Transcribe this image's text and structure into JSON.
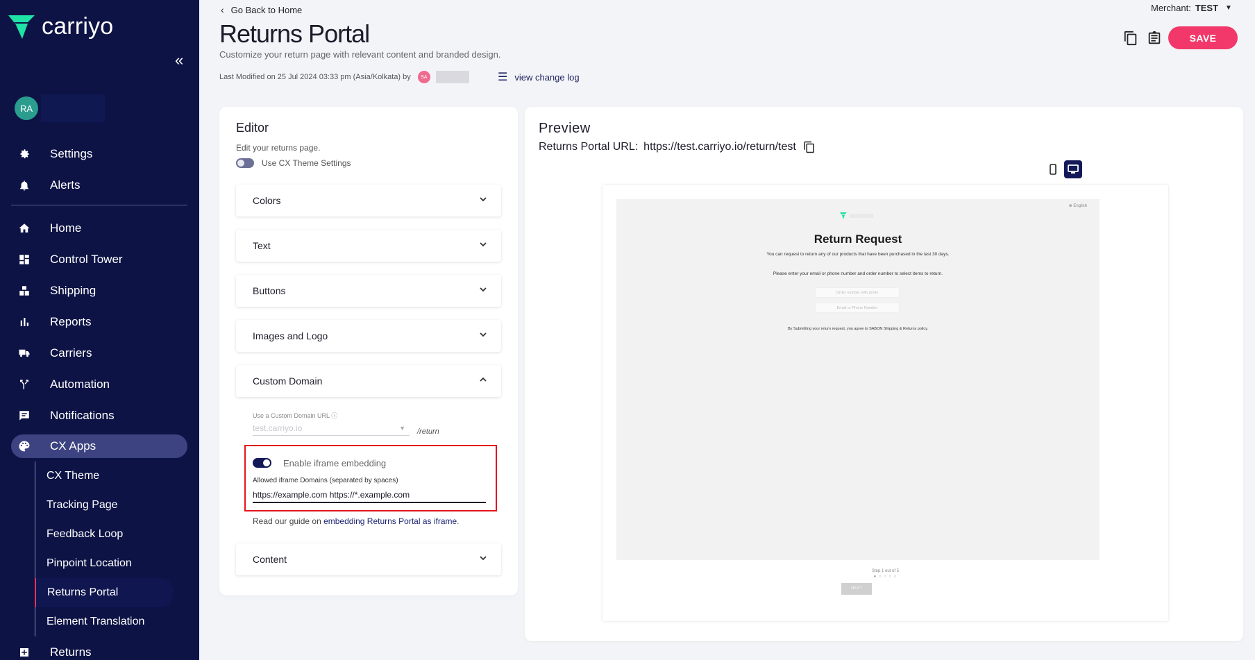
{
  "app": {
    "brand": "carriyo",
    "collapse_icon": "double-chevron-left-icon"
  },
  "user": {
    "initials": "RA"
  },
  "sidebar": {
    "top_items": [
      {
        "label": "Settings",
        "icon": "gear-icon"
      },
      {
        "label": "Alerts",
        "icon": "bell-icon"
      }
    ],
    "main_items": [
      {
        "label": "Home",
        "icon": "home-icon"
      },
      {
        "label": "Control Tower",
        "icon": "dashboard-icon"
      },
      {
        "label": "Shipping",
        "icon": "boxes-icon"
      },
      {
        "label": "Reports",
        "icon": "bar-chart-icon"
      },
      {
        "label": "Carriers",
        "icon": "truck-icon"
      },
      {
        "label": "Automation",
        "icon": "fork-icon"
      },
      {
        "label": "Notifications",
        "icon": "message-icon"
      },
      {
        "label": "CX Apps",
        "icon": "palette-icon"
      }
    ],
    "sub_items": [
      {
        "label": "CX Theme"
      },
      {
        "label": "Tracking Page"
      },
      {
        "label": "Feedback Loop"
      },
      {
        "label": "Pinpoint Location"
      },
      {
        "label": "Returns Portal"
      },
      {
        "label": "Element Translation"
      }
    ],
    "bottom_item": {
      "label": "Returns",
      "icon": "returns-icon"
    }
  },
  "header": {
    "back_label": "Go Back to Home",
    "title": "Returns Portal",
    "subtitle": "Customize your return page with relevant content and branded design.",
    "last_modified": "Last Modified on 25 Jul 2024 03:33 pm (Asia/Kolkata) by",
    "modifier_initials": "SA",
    "changelog_label": "view change log",
    "merchant_label": "Merchant:",
    "merchant_value": "TEST",
    "save_label": "SAVE"
  },
  "editor": {
    "title": "Editor",
    "description": "Edit your returns page.",
    "cx_theme_toggle_label": "Use CX Theme Settings",
    "sections": [
      "Colors",
      "Text",
      "Buttons",
      "Images and Logo",
      "Custom Domain"
    ],
    "last_section": "Content",
    "custom_domain": {
      "label": "Use a Custom Domain URL",
      "selected": "test.carriyo.io",
      "suffix": "/return",
      "iframe_toggle_label": "Enable iframe embedding",
      "domains_label": "Allowed iframe Domains (separated by spaces)",
      "domains_value": "https://example.com https://*.example.com",
      "guide_prefix": "Read our guide on ",
      "guide_link": "embedding Returns Portal as iframe",
      "guide_suffix": "."
    }
  },
  "preview": {
    "title": "Preview",
    "url_label": "Returns Portal URL:",
    "url_value": "https://test.carriyo.io/return/test",
    "mock": {
      "language": "English",
      "title": "Return Request",
      "text1": "You can request to return any of our products that have been purchased in the last 30 days.",
      "text2": "Please enter your email or phone number and order number to select items to return.",
      "input1_placeholder": "Order number with prefix",
      "input2_placeholder": "Email or Phone Number",
      "text3": "By Submitting your return request, you agree to SABON Shipping & Returns policy.",
      "step": "Step 1 out of 5",
      "next": "NEXT"
    }
  },
  "colors": {
    "sidebar_bg": "#0d1345",
    "accent": "#f2386a",
    "highlight_border": "#e3141c"
  }
}
